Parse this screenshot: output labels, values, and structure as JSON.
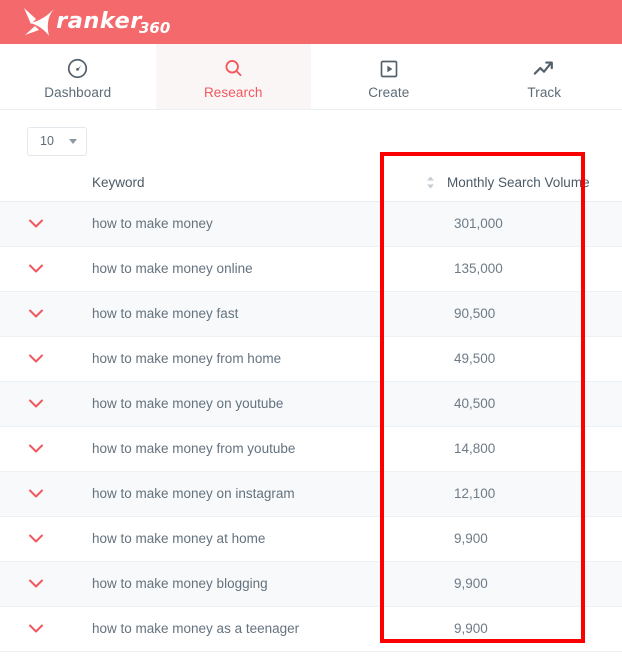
{
  "brand": {
    "logo_word": "ranker",
    "logo_suffix": "360",
    "logo_mark_icon": "x-mark-icon",
    "header_color": "#F4696C"
  },
  "nav": {
    "tabs": [
      {
        "label": "Dashboard",
        "icon": "gauge-icon",
        "active": false
      },
      {
        "label": "Research",
        "icon": "search-icon",
        "active": true
      },
      {
        "label": "Create",
        "icon": "play-square-icon",
        "active": false
      },
      {
        "label": "Track",
        "icon": "trending-up-icon",
        "active": false
      }
    ],
    "active_color": "#F1595E",
    "inactive_color": "#5C6B77"
  },
  "toolbar": {
    "page_size_value": "10",
    "page_size_icon": "chevron-down-icon"
  },
  "table": {
    "headers": {
      "expander": "",
      "keyword": "Keyword",
      "volume": "Monthly Search Volume"
    },
    "sort_icon": "sort-updown-icon",
    "row_expander_icon": "chevron-down-icon",
    "rows": [
      {
        "keyword": "how to make money",
        "volume": "301,000"
      },
      {
        "keyword": "how to make money online",
        "volume": "135,000"
      },
      {
        "keyword": "how to make money fast",
        "volume": "90,500"
      },
      {
        "keyword": "how to make money from home",
        "volume": "49,500"
      },
      {
        "keyword": "how to make money on youtube",
        "volume": "40,500"
      },
      {
        "keyword": "how to make money from youtube",
        "volume": "14,800"
      },
      {
        "keyword": "how to make money on instagram",
        "volume": "12,100"
      },
      {
        "keyword": "how to make money at home",
        "volume": "9,900"
      },
      {
        "keyword": "how to make money blogging",
        "volume": "9,900"
      },
      {
        "keyword": "how to make money as a teenager",
        "volume": "9,900"
      }
    ]
  },
  "annotation": {
    "shape": "rectangle-highlight",
    "color": "#FC0000"
  }
}
